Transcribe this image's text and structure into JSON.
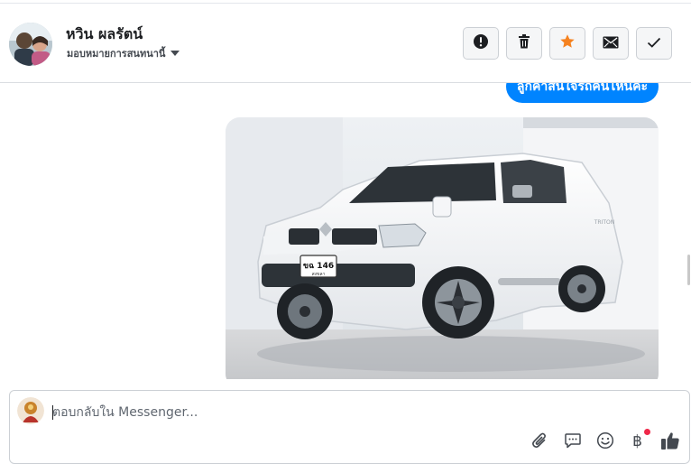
{
  "header": {
    "contact_name": "หวิน ผลรัตน์",
    "assign_label": "มอบหมายการสนทนานี้",
    "actions": [
      {
        "name": "mark-spam",
        "icon": "exclamation-circle-icon"
      },
      {
        "name": "delete",
        "icon": "trash-icon"
      },
      {
        "name": "star",
        "icon": "star-icon"
      },
      {
        "name": "mark-unread",
        "icon": "envelope-icon"
      },
      {
        "name": "mark-done",
        "icon": "checkmark-icon"
      }
    ]
  },
  "chat": {
    "outgoing_message": "ลูกค้าสนใจรถคันไหนคะ",
    "image_plate_top": "ขฉ 146",
    "image_plate_bottom": "สงขลา",
    "image_badge": "TRITON"
  },
  "composer": {
    "placeholder": "ตอบกลับใน Messenger...",
    "tools": [
      "paperclip-icon",
      "saved-reply-icon",
      "emoji-icon",
      "baht-payment-icon",
      "thumbs-up-icon"
    ],
    "baht_symbol": "฿"
  },
  "colors": {
    "accent": "#0084ff",
    "star": "#f58220",
    "notification": "#f02849",
    "icon": "#444950"
  }
}
